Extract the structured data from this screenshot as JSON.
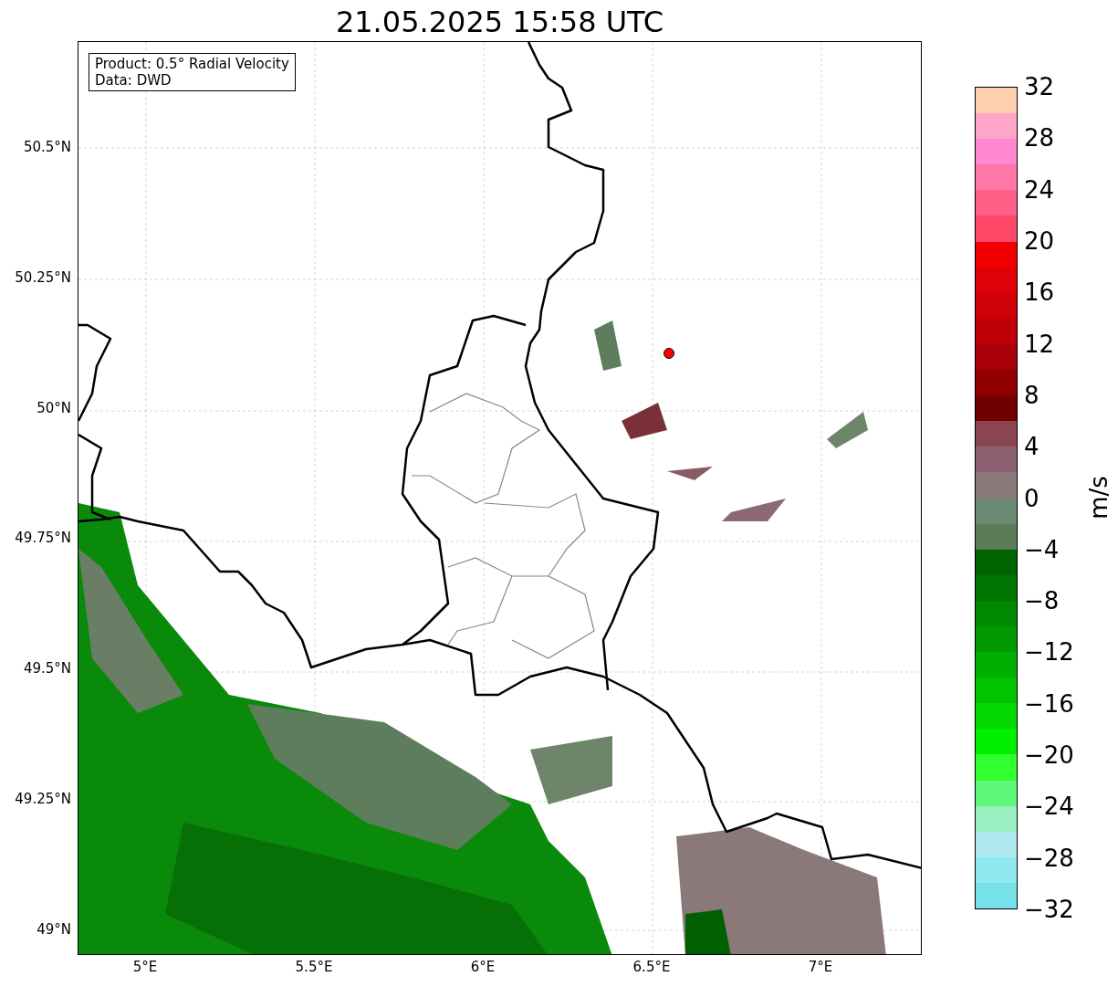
{
  "title": "21.05.2025 15:58 UTC",
  "map": {
    "info_lines": [
      "Product: 0.5° Radial Velocity",
      "Data: DWD"
    ],
    "yticks": [
      "50.5°N",
      "50.25°N",
      "50°N",
      "49.75°N",
      "49.5°N",
      "49.25°N",
      "49°N"
    ],
    "xticks": [
      "5°E",
      "5.5°E",
      "6°E",
      "6.5°E",
      "7°E"
    ]
  },
  "colorbar": {
    "label": "m/s",
    "ticks": [
      "32",
      "28",
      "24",
      "20",
      "16",
      "12",
      "8",
      "4",
      "0",
      "−4",
      "−8",
      "−12",
      "−16",
      "−20",
      "−24",
      "−28",
      "−32"
    ],
    "bands": [
      {
        "color": "#ffcfb0"
      },
      {
        "color": "#ffa6c8"
      },
      {
        "color": "#ff88d0"
      },
      {
        "color": "#ff76a8"
      },
      {
        "color": "#ff6088"
      },
      {
        "color": "#ff4868"
      },
      {
        "color": "#f20000"
      },
      {
        "color": "#e00008"
      },
      {
        "color": "#d00008"
      },
      {
        "color": "#c00008"
      },
      {
        "color": "#a80008"
      },
      {
        "color": "#900000"
      },
      {
        "color": "#700000"
      },
      {
        "color": "#8b4650"
      },
      {
        "color": "#8b6070"
      },
      {
        "color": "#8b7878"
      },
      {
        "color": "#6b8870"
      },
      {
        "color": "#5c7c58"
      },
      {
        "color": "#006400"
      },
      {
        "color": "#007400"
      },
      {
        "color": "#008800"
      },
      {
        "color": "#009a00"
      },
      {
        "color": "#00b000"
      },
      {
        "color": "#00c400"
      },
      {
        "color": "#00d800"
      },
      {
        "color": "#00f000"
      },
      {
        "color": "#30ff30"
      },
      {
        "color": "#60f878"
      },
      {
        "color": "#98f0c0"
      },
      {
        "color": "#b0e8f0"
      },
      {
        "color": "#90e8f0"
      },
      {
        "color": "#78e0e8"
      }
    ]
  }
}
